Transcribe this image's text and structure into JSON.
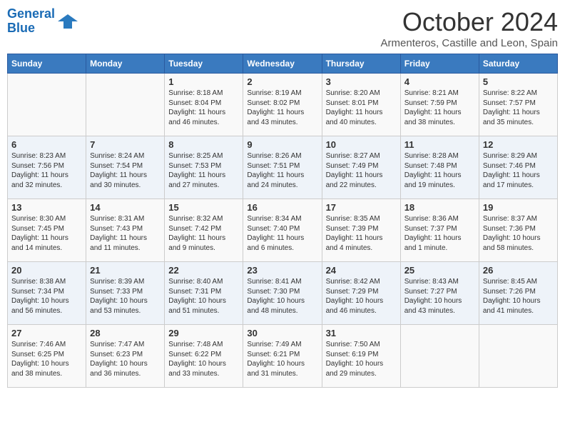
{
  "header": {
    "logo_line1": "General",
    "logo_line2": "Blue",
    "month_title": "October 2024",
    "subtitle": "Armenteros, Castille and Leon, Spain"
  },
  "days_of_week": [
    "Sunday",
    "Monday",
    "Tuesday",
    "Wednesday",
    "Thursday",
    "Friday",
    "Saturday"
  ],
  "weeks": [
    [
      {
        "day": "",
        "info": ""
      },
      {
        "day": "",
        "info": ""
      },
      {
        "day": "1",
        "info": "Sunrise: 8:18 AM\nSunset: 8:04 PM\nDaylight: 11 hours and 46 minutes."
      },
      {
        "day": "2",
        "info": "Sunrise: 8:19 AM\nSunset: 8:02 PM\nDaylight: 11 hours and 43 minutes."
      },
      {
        "day": "3",
        "info": "Sunrise: 8:20 AM\nSunset: 8:01 PM\nDaylight: 11 hours and 40 minutes."
      },
      {
        "day": "4",
        "info": "Sunrise: 8:21 AM\nSunset: 7:59 PM\nDaylight: 11 hours and 38 minutes."
      },
      {
        "day": "5",
        "info": "Sunrise: 8:22 AM\nSunset: 7:57 PM\nDaylight: 11 hours and 35 minutes."
      }
    ],
    [
      {
        "day": "6",
        "info": "Sunrise: 8:23 AM\nSunset: 7:56 PM\nDaylight: 11 hours and 32 minutes."
      },
      {
        "day": "7",
        "info": "Sunrise: 8:24 AM\nSunset: 7:54 PM\nDaylight: 11 hours and 30 minutes."
      },
      {
        "day": "8",
        "info": "Sunrise: 8:25 AM\nSunset: 7:53 PM\nDaylight: 11 hours and 27 minutes."
      },
      {
        "day": "9",
        "info": "Sunrise: 8:26 AM\nSunset: 7:51 PM\nDaylight: 11 hours and 24 minutes."
      },
      {
        "day": "10",
        "info": "Sunrise: 8:27 AM\nSunset: 7:49 PM\nDaylight: 11 hours and 22 minutes."
      },
      {
        "day": "11",
        "info": "Sunrise: 8:28 AM\nSunset: 7:48 PM\nDaylight: 11 hours and 19 minutes."
      },
      {
        "day": "12",
        "info": "Sunrise: 8:29 AM\nSunset: 7:46 PM\nDaylight: 11 hours and 17 minutes."
      }
    ],
    [
      {
        "day": "13",
        "info": "Sunrise: 8:30 AM\nSunset: 7:45 PM\nDaylight: 11 hours and 14 minutes."
      },
      {
        "day": "14",
        "info": "Sunrise: 8:31 AM\nSunset: 7:43 PM\nDaylight: 11 hours and 11 minutes."
      },
      {
        "day": "15",
        "info": "Sunrise: 8:32 AM\nSunset: 7:42 PM\nDaylight: 11 hours and 9 minutes."
      },
      {
        "day": "16",
        "info": "Sunrise: 8:34 AM\nSunset: 7:40 PM\nDaylight: 11 hours and 6 minutes."
      },
      {
        "day": "17",
        "info": "Sunrise: 8:35 AM\nSunset: 7:39 PM\nDaylight: 11 hours and 4 minutes."
      },
      {
        "day": "18",
        "info": "Sunrise: 8:36 AM\nSunset: 7:37 PM\nDaylight: 11 hours and 1 minute."
      },
      {
        "day": "19",
        "info": "Sunrise: 8:37 AM\nSunset: 7:36 PM\nDaylight: 10 hours and 58 minutes."
      }
    ],
    [
      {
        "day": "20",
        "info": "Sunrise: 8:38 AM\nSunset: 7:34 PM\nDaylight: 10 hours and 56 minutes."
      },
      {
        "day": "21",
        "info": "Sunrise: 8:39 AM\nSunset: 7:33 PM\nDaylight: 10 hours and 53 minutes."
      },
      {
        "day": "22",
        "info": "Sunrise: 8:40 AM\nSunset: 7:31 PM\nDaylight: 10 hours and 51 minutes."
      },
      {
        "day": "23",
        "info": "Sunrise: 8:41 AM\nSunset: 7:30 PM\nDaylight: 10 hours and 48 minutes."
      },
      {
        "day": "24",
        "info": "Sunrise: 8:42 AM\nSunset: 7:29 PM\nDaylight: 10 hours and 46 minutes."
      },
      {
        "day": "25",
        "info": "Sunrise: 8:43 AM\nSunset: 7:27 PM\nDaylight: 10 hours and 43 minutes."
      },
      {
        "day": "26",
        "info": "Sunrise: 8:45 AM\nSunset: 7:26 PM\nDaylight: 10 hours and 41 minutes."
      }
    ],
    [
      {
        "day": "27",
        "info": "Sunrise: 7:46 AM\nSunset: 6:25 PM\nDaylight: 10 hours and 38 minutes."
      },
      {
        "day": "28",
        "info": "Sunrise: 7:47 AM\nSunset: 6:23 PM\nDaylight: 10 hours and 36 minutes."
      },
      {
        "day": "29",
        "info": "Sunrise: 7:48 AM\nSunset: 6:22 PM\nDaylight: 10 hours and 33 minutes."
      },
      {
        "day": "30",
        "info": "Sunrise: 7:49 AM\nSunset: 6:21 PM\nDaylight: 10 hours and 31 minutes."
      },
      {
        "day": "31",
        "info": "Sunrise: 7:50 AM\nSunset: 6:19 PM\nDaylight: 10 hours and 29 minutes."
      },
      {
        "day": "",
        "info": ""
      },
      {
        "day": "",
        "info": ""
      }
    ]
  ]
}
